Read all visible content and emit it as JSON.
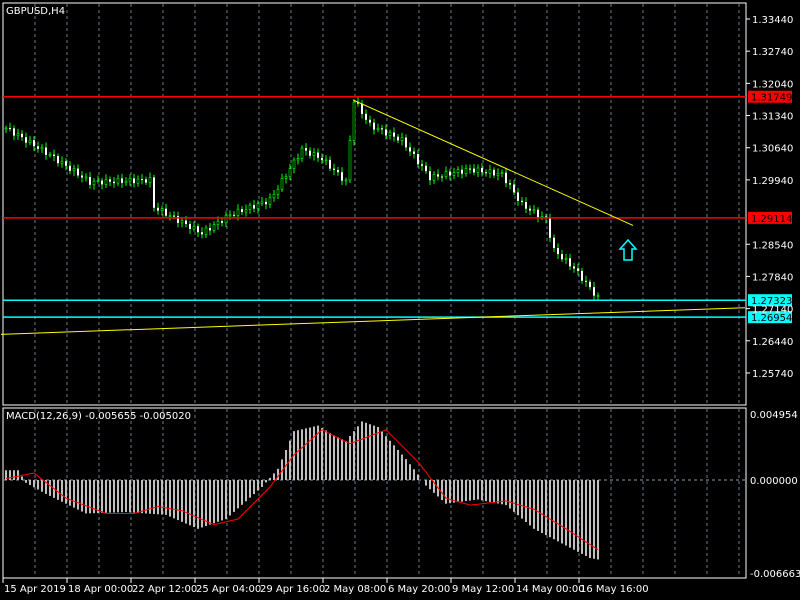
{
  "chart_data": [
    {
      "type": "candlestick",
      "title": "GBPUSD,H4",
      "ylim": [
        1.2505,
        1.3401
      ],
      "y_ticks": [
        "1.33440",
        "1.32740",
        "1.32040",
        "1.31340",
        "1.30640",
        "1.29940",
        "1.28540",
        "1.27840",
        "1.27140",
        "1.26440",
        "1.25740"
      ],
      "price_levels": [
        {
          "label": "1.31749",
          "value": 1.31749,
          "color": "#ff0000"
        },
        {
          "label": "1.29114",
          "value": 1.29114,
          "color": "#ff0000"
        },
        {
          "label": "1.27323",
          "value": 1.27323,
          "color": "#00ffff"
        },
        {
          "label": "1.26954",
          "value": 1.26954,
          "color": "#00ffff"
        }
      ],
      "close_keypoints": [
        [
          0,
          1.3107
        ],
        [
          11,
          1.3048
        ],
        [
          21,
          1.2989
        ],
        [
          36,
          1.2994
        ],
        [
          37,
          1.2935
        ],
        [
          49,
          1.2878
        ],
        [
          56,
          1.2918
        ],
        [
          66,
          1.295
        ],
        [
          74,
          1.306
        ],
        [
          79,
          1.304
        ],
        [
          85,
          1.299
        ],
        [
          87,
          1.3168
        ],
        [
          91,
          1.3113
        ],
        [
          99,
          1.308
        ],
        [
          106,
          1.2999
        ],
        [
          116,
          1.3017
        ],
        [
          124,
          1.3006
        ],
        [
          129,
          1.294
        ],
        [
          135,
          1.2907
        ],
        [
          137,
          1.2841
        ],
        [
          142,
          1.2802
        ],
        [
          148,
          1.2737
        ]
      ],
      "trendlines": [
        {
          "from": [
            87,
            1.3168
          ],
          "to": [
            157,
            1.2895
          ],
          "color": "#ffff00"
        },
        {
          "from": [
            -1,
            1.2658
          ],
          "to": [
            185,
            1.2716
          ],
          "color": "#ffff00"
        }
      ],
      "x_labels": [
        "15 Apr 2019",
        "18 Apr 00:00",
        "22 Apr 12:00",
        "25 Apr 04:00",
        "29 Apr 16:00",
        "2 May 08:00",
        "6 May 20:00",
        "9 May 12:00",
        "14 May 00:00",
        "16 May 16:00"
      ],
      "arrow_color": "#00ffff"
    },
    {
      "type": "bar+line",
      "title": "MACD(12,26,9) -0.005655 -0.005020",
      "ylim": [
        -0.006663,
        0.004954
      ],
      "y_ticks": [
        "0.004954",
        "0.000000",
        "-0.006663"
      ],
      "histogram_keypoints": [
        [
          0,
          0.0007
        ],
        [
          3,
          0.0007
        ],
        [
          5,
          -0.0002
        ],
        [
          10,
          -0.001
        ],
        [
          20,
          -0.0024
        ],
        [
          30,
          -0.0023
        ],
        [
          40,
          -0.0025
        ],
        [
          48,
          -0.0035
        ],
        [
          55,
          -0.0028
        ],
        [
          64,
          -0.0005
        ],
        [
          68,
          0.0008
        ],
        [
          72,
          0.0035
        ],
        [
          78,
          0.0039
        ],
        [
          82,
          0.0032
        ],
        [
          85,
          0.0028
        ],
        [
          89,
          0.0042
        ],
        [
          93,
          0.0038
        ],
        [
          100,
          0.0015
        ],
        [
          103,
          0.0004
        ],
        [
          105,
          -0.0004
        ],
        [
          110,
          -0.0017
        ],
        [
          118,
          -0.0014
        ],
        [
          125,
          -0.0018
        ],
        [
          132,
          -0.0035
        ],
        [
          140,
          -0.0047
        ],
        [
          146,
          -0.0056
        ],
        [
          148,
          -0.0057
        ]
      ],
      "signal_keypoints": [
        [
          0,
          0.0001
        ],
        [
          7,
          0.0005
        ],
        [
          15,
          -0.0013
        ],
        [
          25,
          -0.0024
        ],
        [
          32,
          -0.0024
        ],
        [
          38,
          -0.0019
        ],
        [
          44,
          -0.0022
        ],
        [
          52,
          -0.0032
        ],
        [
          58,
          -0.0028
        ],
        [
          66,
          -0.0005
        ],
        [
          72,
          0.0018
        ],
        [
          79,
          0.0036
        ],
        [
          86,
          0.0026
        ],
        [
          95,
          0.0036
        ],
        [
          103,
          0.0013
        ],
        [
          110,
          -0.0013
        ],
        [
          116,
          -0.0018
        ],
        [
          125,
          -0.0015
        ],
        [
          132,
          -0.0021
        ],
        [
          140,
          -0.0035
        ],
        [
          148,
          -0.005
        ]
      ],
      "colors": {
        "histogram": "#c0c0c0",
        "signal": "#ff0000"
      }
    }
  ]
}
